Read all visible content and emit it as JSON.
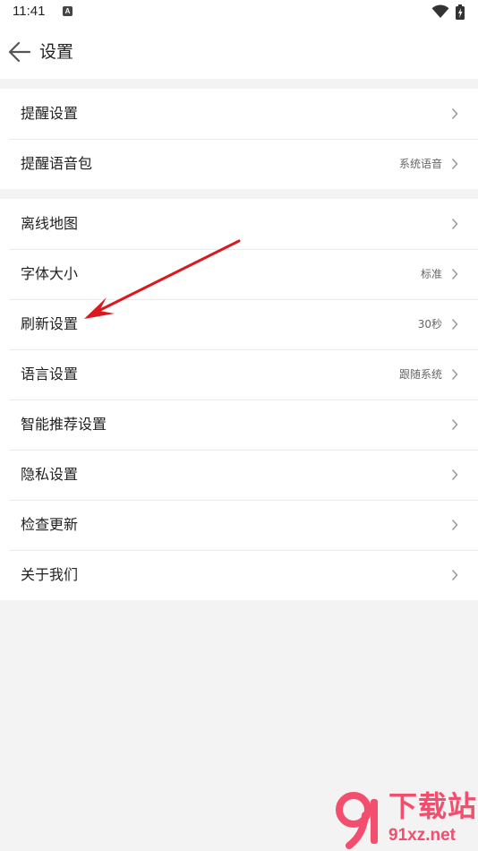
{
  "status_bar": {
    "time": "11:41",
    "notification_icon": "A"
  },
  "header": {
    "title": "设置",
    "back_icon": "arrow-left-icon"
  },
  "groups": [
    {
      "items": [
        {
          "label": "提醒设置",
          "value": ""
        },
        {
          "label": "提醒语音包",
          "value": "系统语音"
        }
      ]
    },
    {
      "items": [
        {
          "label": "离线地图",
          "value": ""
        },
        {
          "label": "字体大小",
          "value": "标准"
        },
        {
          "label": "刷新设置",
          "value": "30秒"
        },
        {
          "label": "语言设置",
          "value": "跟随系统"
        },
        {
          "label": "智能推荐设置",
          "value": ""
        },
        {
          "label": "隐私设置",
          "value": ""
        },
        {
          "label": "检查更新",
          "value": ""
        },
        {
          "label": "关于我们",
          "value": ""
        }
      ]
    }
  ],
  "watermark": {
    "cn": "下载站",
    "en": "91xz.net"
  },
  "colors": {
    "annotation_arrow": "#d9191f",
    "watermark": "#f24e6e",
    "background": "#f3f3f3"
  }
}
